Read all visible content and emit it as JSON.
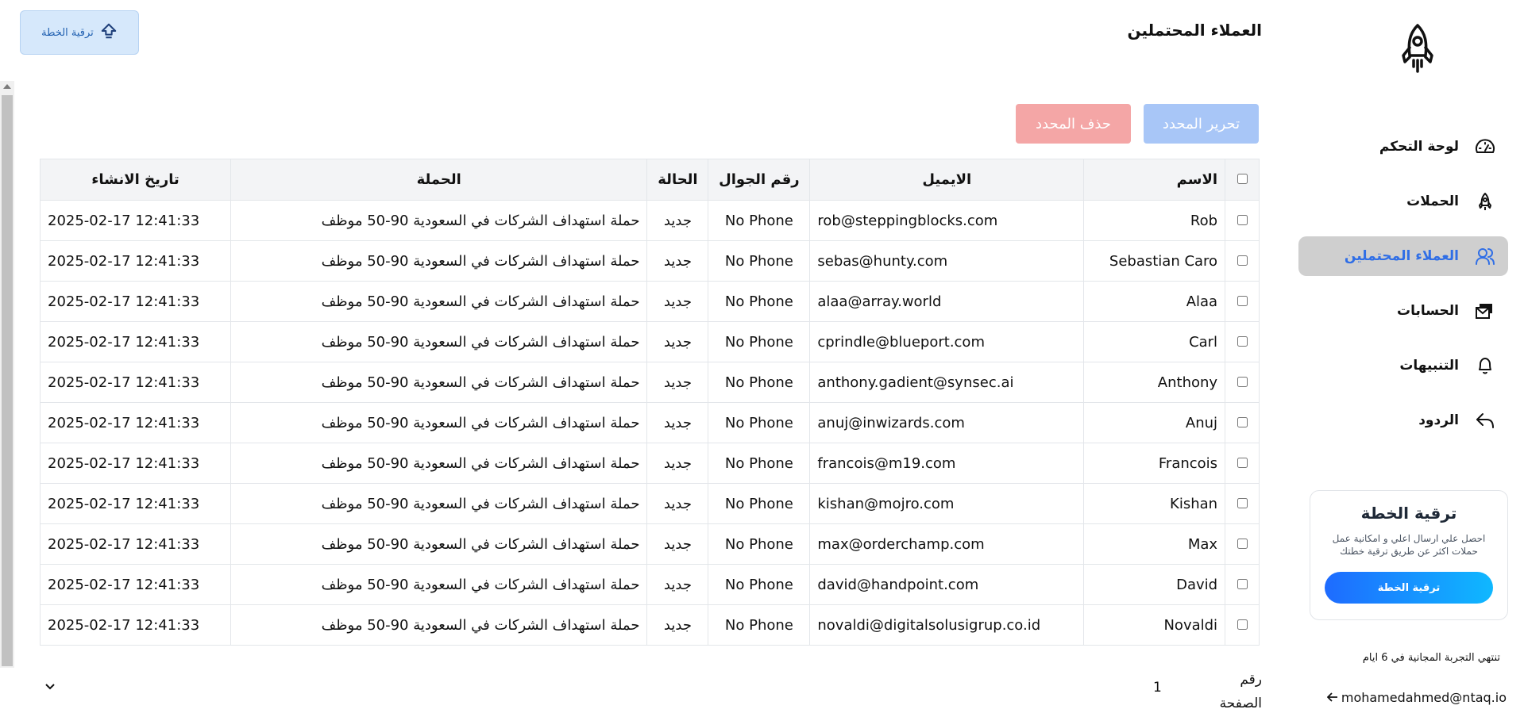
{
  "header": {
    "upgrade_button_label": "ترقية الخطة",
    "page_title": "العملاء المحتملين"
  },
  "sidebar": {
    "items": [
      {
        "label": "لوحة التحكم",
        "icon": "gauge-icon",
        "active": false
      },
      {
        "label": "الحملات",
        "icon": "rocket-icon",
        "active": false
      },
      {
        "label": "العملاء المحتملين",
        "icon": "users-icon",
        "active": true
      },
      {
        "label": "الحسابات",
        "icon": "envelope-stack-icon",
        "active": false
      },
      {
        "label": "التنبيهات",
        "icon": "bell-icon",
        "active": false
      },
      {
        "label": "الردود",
        "icon": "reply-icon",
        "active": false
      }
    ],
    "upgrade_card": {
      "title": "ترقية الخطة",
      "description": "احصل علي ارسال اعلي و امكانية عمل حملات اكثر عن طريق ترقية خطتك",
      "button_label": "ترقية الخطة"
    },
    "trial_text": "تنتهي التجربة المجانية في 6 ايام",
    "user_email": "mohamedahmed@ntaq.io"
  },
  "toolbar": {
    "edit_label": "تحرير المحدد",
    "delete_label": "حذف المحدد"
  },
  "table": {
    "columns": {
      "name": "الاسم",
      "email": "الايميل",
      "phone": "رقم الجوال",
      "status": "الحالة",
      "campaign": "الحملة",
      "created": "تاريخ الانشاء"
    },
    "rows": [
      {
        "name": "Rob",
        "email": "rob@steppingblocks.com",
        "phone": "No Phone",
        "status": "جديد",
        "campaign": "حملة استهداف الشركات في السعودية 90-50 موظف",
        "created": "2025-02-17 12:41:33"
      },
      {
        "name": "Sebastian Caro",
        "email": "sebas@hunty.com",
        "phone": "No Phone",
        "status": "جديد",
        "campaign": "حملة استهداف الشركات في السعودية 90-50 موظف",
        "created": "2025-02-17 12:41:33"
      },
      {
        "name": "Alaa",
        "email": "alaa@array.world",
        "phone": "No Phone",
        "status": "جديد",
        "campaign": "حملة استهداف الشركات في السعودية 90-50 موظف",
        "created": "2025-02-17 12:41:33"
      },
      {
        "name": "Carl",
        "email": "cprindle@blueport.com",
        "phone": "No Phone",
        "status": "جديد",
        "campaign": "حملة استهداف الشركات في السعودية 90-50 موظف",
        "created": "2025-02-17 12:41:33"
      },
      {
        "name": "Anthony",
        "email": "anthony.gadient@synsec.ai",
        "phone": "No Phone",
        "status": "جديد",
        "campaign": "حملة استهداف الشركات في السعودية 90-50 موظف",
        "created": "2025-02-17 12:41:33"
      },
      {
        "name": "Anuj",
        "email": "anuj@inwizards.com",
        "phone": "No Phone",
        "status": "جديد",
        "campaign": "حملة استهداف الشركات في السعودية 90-50 موظف",
        "created": "2025-02-17 12:41:33"
      },
      {
        "name": "Francois",
        "email": "francois@m19.com",
        "phone": "No Phone",
        "status": "جديد",
        "campaign": "حملة استهداف الشركات في السعودية 90-50 موظف",
        "created": "2025-02-17 12:41:33"
      },
      {
        "name": "Kishan",
        "email": "kishan@mojro.com",
        "phone": "No Phone",
        "status": "جديد",
        "campaign": "حملة استهداف الشركات في السعودية 90-50 موظف",
        "created": "2025-02-17 12:41:33"
      },
      {
        "name": "Max",
        "email": "max@orderchamp.com",
        "phone": "No Phone",
        "status": "جديد",
        "campaign": "حملة استهداف الشركات في السعودية 90-50 موظف",
        "created": "2025-02-17 12:41:33"
      },
      {
        "name": "David",
        "email": "david@handpoint.com",
        "phone": "No Phone",
        "status": "جديد",
        "campaign": "حملة استهداف الشركات في السعودية 90-50 موظف",
        "created": "2025-02-17 12:41:33"
      },
      {
        "name": "Novaldi",
        "email": "novaldi@digitalsolusigrup.co.id",
        "phone": "No Phone",
        "status": "جديد",
        "campaign": "حملة استهداف الشركات في السعودية 90-50 موظف",
        "created": "2025-02-17 12:41:33"
      }
    ]
  },
  "pagination": {
    "label": "رقم الصفحة",
    "current_page": "1"
  },
  "colors": {
    "accent": "#2f6ee6",
    "edit_button": "#a8c6f7",
    "delete_button": "#f4a6a6",
    "active_nav_bg": "#cfcfcf"
  }
}
